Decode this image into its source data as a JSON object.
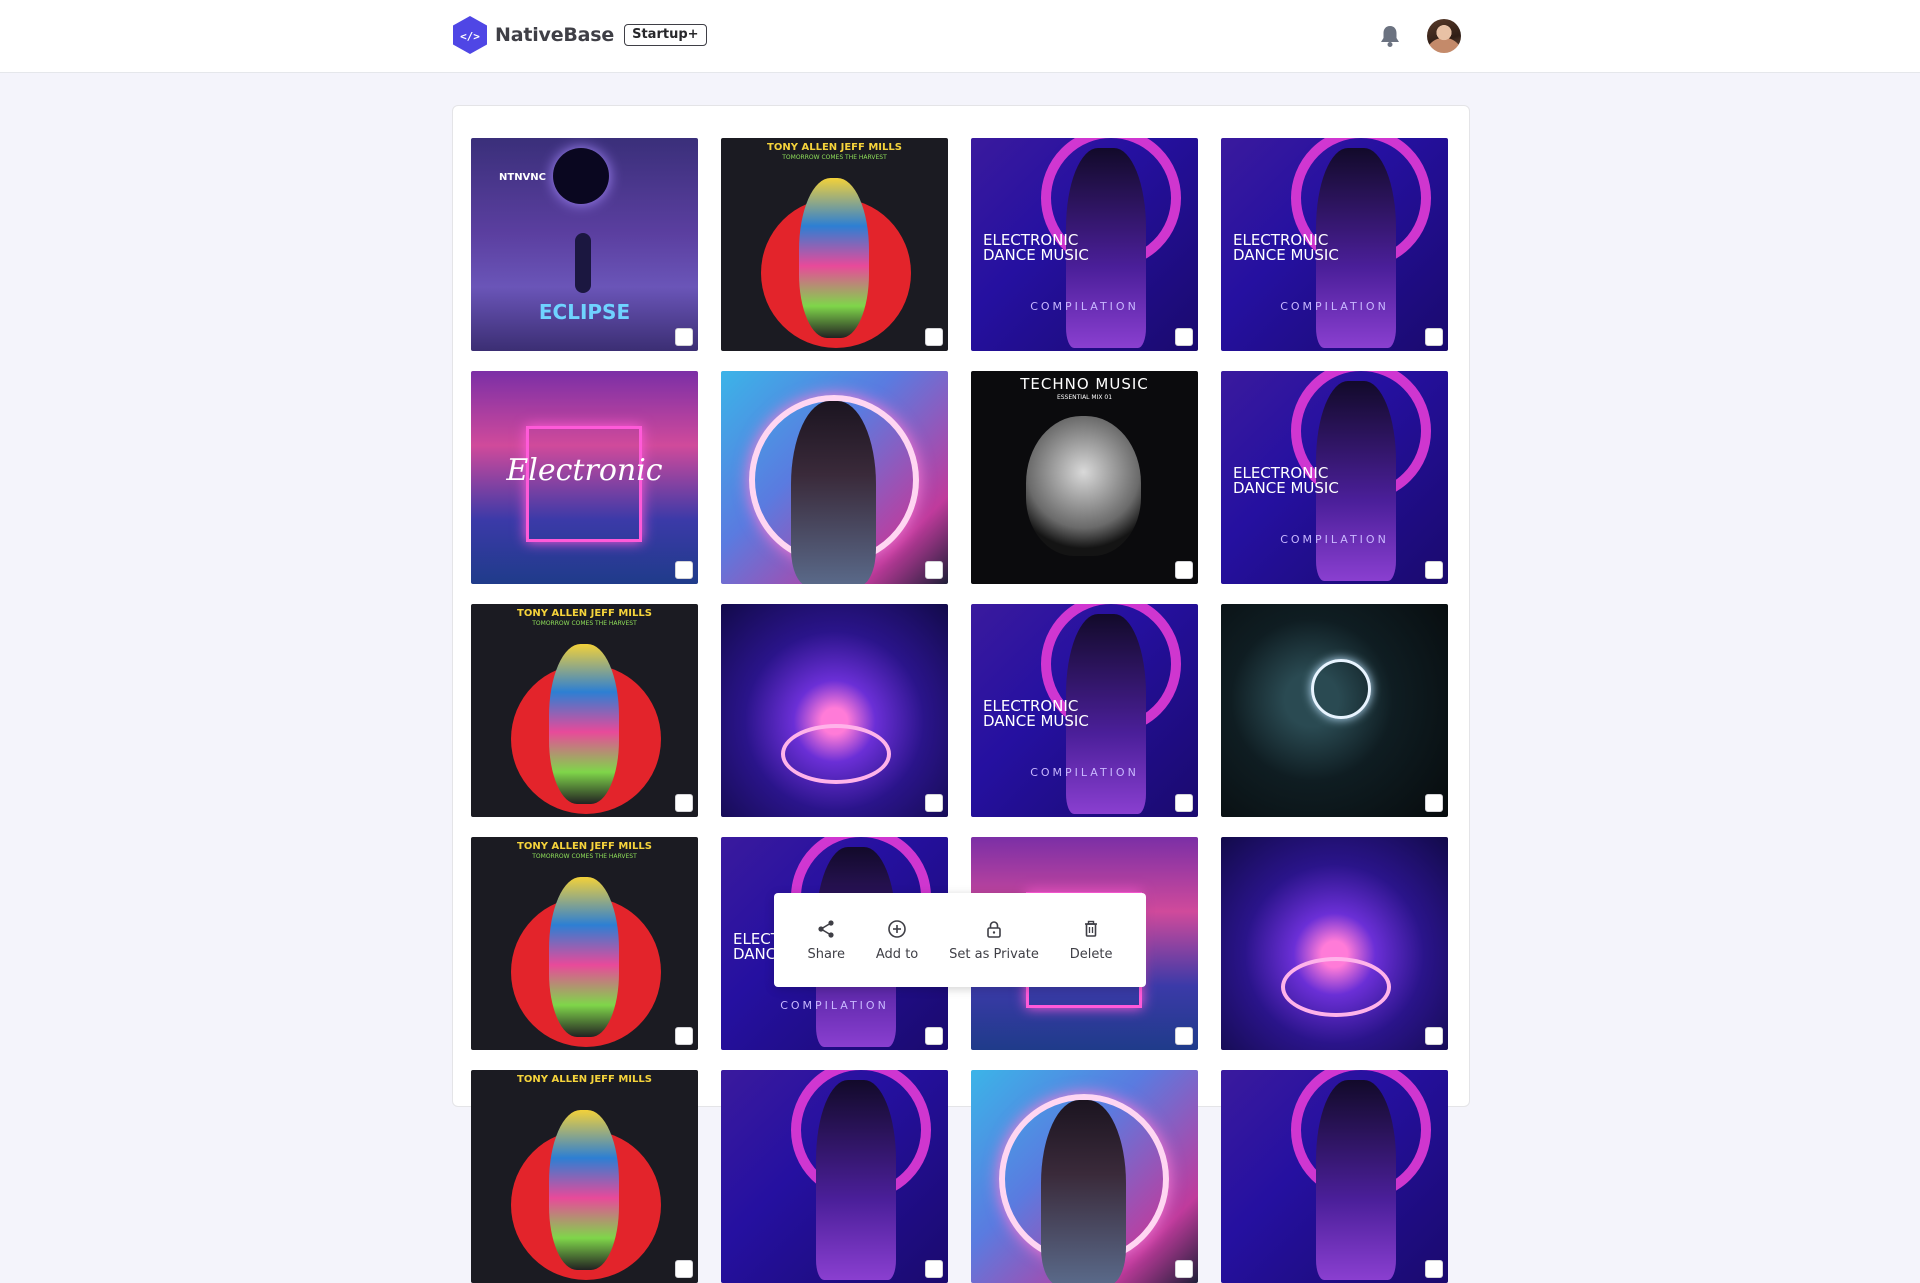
{
  "header": {
    "brand_name": "NativeBase",
    "plan_badge": "Startup+"
  },
  "icons": {
    "logo": "code-hexagon-icon",
    "notifications": "bell-icon",
    "share": "share-icon",
    "add": "plus-circle-icon",
    "private": "lock-icon",
    "delete": "trash-icon"
  },
  "colors": {
    "brand": "#4f46e5",
    "background": "#f4f4fb",
    "panel": "#ffffff"
  },
  "gallery": {
    "items": [
      {
        "art": "eclipse",
        "title": "ECLIPSE",
        "caption": "NTNVNC"
      },
      {
        "art": "tony",
        "title": "TONY ALLEN JEFF MILLS",
        "caption": "TOMORROW COMES THE HARVEST"
      },
      {
        "art": "edm",
        "title": "ELECTRONIC DANCE MUSIC",
        "caption": "COMPILATION"
      },
      {
        "art": "edm",
        "title": "ELECTRONIC DANCE MUSIC",
        "caption": "COMPILATION"
      },
      {
        "art": "electronic",
        "title": "Electronic",
        "caption": ""
      },
      {
        "art": "neon",
        "title": "",
        "caption": ""
      },
      {
        "art": "techno",
        "title": "TECHNO MUSIC",
        "caption": "ESSENTIAL MIX 01"
      },
      {
        "art": "edm",
        "title": "ELECTRONIC DANCE MUSIC",
        "caption": "COMPILATION"
      },
      {
        "art": "tony",
        "title": "TONY ALLEN JEFF MILLS",
        "caption": "TOMORROW COMES THE HARVEST"
      },
      {
        "art": "psy",
        "title": "",
        "caption": ""
      },
      {
        "art": "edm",
        "title": "ELECTRONIC DANCE MUSIC",
        "caption": "COMPILATION"
      },
      {
        "art": "dark",
        "title": "",
        "caption": ""
      },
      {
        "art": "tony",
        "title": "TONY ALLEN JEFF MILLS",
        "caption": "TOMORROW COMES THE HARVEST"
      },
      {
        "art": "edm",
        "title": "ELECTRONIC DANCE MUSIC",
        "caption": "COMPILATION"
      },
      {
        "art": "electronic",
        "title": "",
        "caption": ""
      },
      {
        "art": "psy",
        "title": "",
        "caption": ""
      },
      {
        "art": "tony",
        "title": "TONY ALLEN JEFF MILLS",
        "caption": ""
      },
      {
        "art": "edm",
        "title": "",
        "caption": ""
      },
      {
        "art": "neon",
        "title": "",
        "caption": ""
      },
      {
        "art": "edm",
        "title": "",
        "caption": ""
      }
    ]
  },
  "context_menu": {
    "share_label": "Share",
    "add_label": "Add to",
    "private_label": "Set as Private",
    "delete_label": "Delete"
  }
}
